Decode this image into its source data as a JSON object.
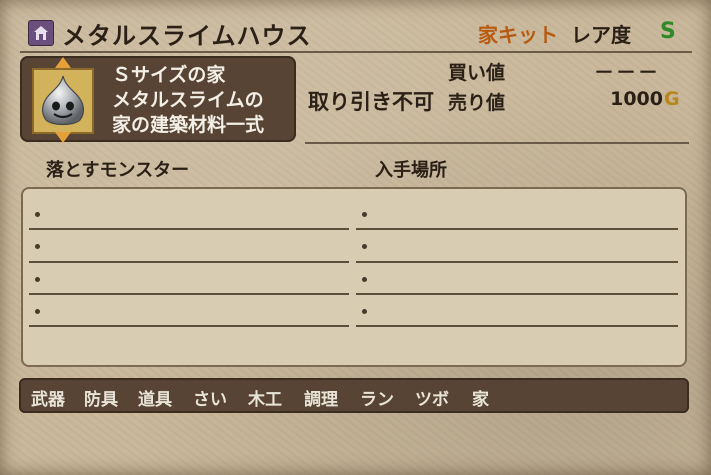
{
  "item": {
    "name": "メタルスライムハウス",
    "category": "家キット",
    "rarity_label": "レア度",
    "rarity_value": "S",
    "description": [
      "Ｓサイズの家",
      "メタルスライムの",
      "家の建築材料一式"
    ],
    "trade_status": "取り引き不可",
    "buy_label": "買い値",
    "buy_value": "－－－",
    "sell_label": "売り値",
    "sell_value": "1000",
    "currency_symbol": "G"
  },
  "sections": {
    "drop_monsters_label": "落とすモンスター",
    "obtain_location_label": "入手場所"
  },
  "nav": [
    "武器",
    "防具",
    "道具",
    "さい",
    "木工",
    "調理",
    "ラン",
    "ツボ",
    "家"
  ],
  "colors": {
    "category": "#b85a10",
    "rarity": "#2f8a27",
    "parchment": "#c9b89b",
    "dark_panel": "#574434"
  },
  "icons": {
    "title_icon": "house-icon",
    "item_icon": "metal-slime-icon"
  }
}
